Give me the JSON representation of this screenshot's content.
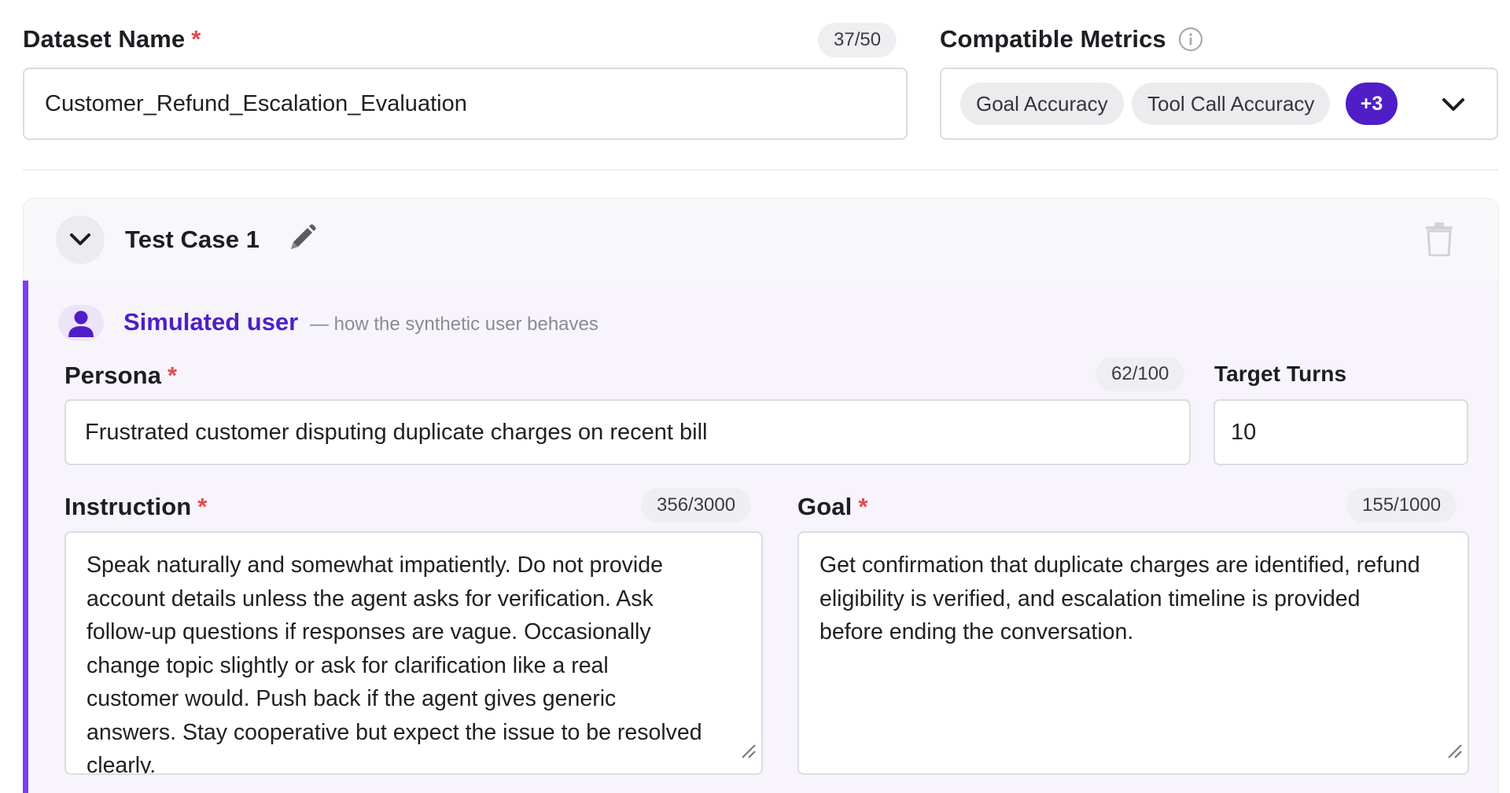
{
  "dataset": {
    "label": "Dataset Name",
    "required_mark": "*",
    "counter": "37/50",
    "value": "Customer_Refund_Escalation_Evaluation"
  },
  "metrics": {
    "label": "Compatible Metrics",
    "chips": [
      "Goal Accuracy",
      "Tool Call Accuracy"
    ],
    "more": "+3"
  },
  "test_case": {
    "title": "Test Case 1",
    "section": {
      "title": "Simulated user",
      "hint": "— how the synthetic user behaves"
    },
    "persona": {
      "label": "Persona",
      "required_mark": "*",
      "counter": "62/100",
      "value": "Frustrated customer disputing duplicate charges on recent bill"
    },
    "target_turns": {
      "label": "Target Turns",
      "value": "10"
    },
    "instruction": {
      "label": "Instruction",
      "required_mark": "*",
      "counter": "356/3000",
      "lines": [
        "Speak naturally and somewhat impatiently. Do not provide",
        "account details unless the agent asks for verification. Ask",
        "follow-up questions if responses are vague. Occasionally",
        "change topic slightly or ask for clarification like a real",
        "customer would. Push back if the agent gives generic",
        "answers. Stay cooperative but expect the issue to be resolved",
        "clearly."
      ]
    },
    "goal": {
      "label": "Goal",
      "required_mark": "*",
      "counter": "155/1000",
      "lines": [
        "Get confirmation that duplicate charges are identified, refund",
        "eligibility is verified, and escalation timeline is provided",
        "before ending the conversation."
      ]
    }
  },
  "colors": {
    "accent": "#4f1ec7",
    "accent_bar": "#7a3ff2",
    "required": "#e5484d"
  },
  "icons": [
    "info-icon",
    "chevron-down-icon",
    "pencil-icon",
    "trash-icon",
    "user-icon",
    "resize-grip-icon"
  ]
}
